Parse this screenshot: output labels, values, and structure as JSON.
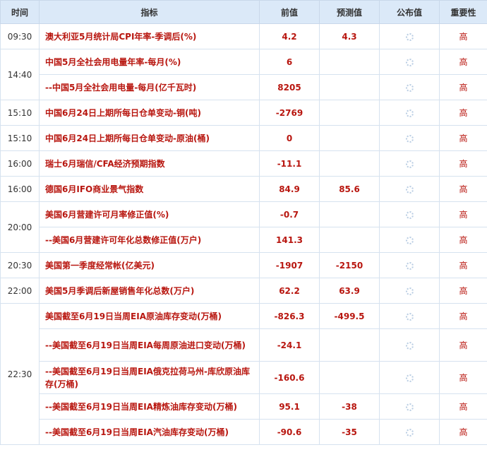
{
  "header": {
    "time": "时间",
    "indicator": "指标",
    "previous": "前值",
    "forecast": "预测值",
    "published": "公布值",
    "importance": "重要性"
  },
  "rows": [
    {
      "time": "09:30",
      "indicator": "澳大利亚5月统计局CPI年率-季调后(%)",
      "previous": "4.2",
      "forecast": "4.3",
      "importance": "高"
    },
    {
      "time": "14:40",
      "indicator": "中国5月全社会用电量年率-每月(%)",
      "previous": "6",
      "forecast": "",
      "importance": "高"
    },
    {
      "time": "",
      "indicator": "--中国5月全社会用电量-每月(亿千瓦时)",
      "previous": "8205",
      "forecast": "",
      "importance": "高"
    },
    {
      "time": "15:10",
      "indicator": "中国6月24日上期所每日仓单变动-铜(吨)",
      "previous": "-2769",
      "forecast": "",
      "importance": "高"
    },
    {
      "time": "15:10",
      "indicator": "中国6月24日上期所每日仓单变动-原油(桶)",
      "previous": "0",
      "forecast": "",
      "importance": "高"
    },
    {
      "time": "16:00",
      "indicator": "瑞士6月瑞信/CFA经济预期指数",
      "previous": "-11.1",
      "forecast": "",
      "importance": "高"
    },
    {
      "time": "16:00",
      "indicator": "德国6月IFO商业景气指数",
      "previous": "84.9",
      "forecast": "85.6",
      "importance": "高"
    },
    {
      "time": "20:00",
      "indicator": "美国6月营建许可月率修正值(%)",
      "previous": "-0.7",
      "forecast": "",
      "importance": "高"
    },
    {
      "time": "",
      "indicator": "--美国6月营建许可年化总数修正值(万户)",
      "previous": "141.3",
      "forecast": "",
      "importance": "高"
    },
    {
      "time": "20:30",
      "indicator": "美国第一季度经常帐(亿美元)",
      "previous": "-1907",
      "forecast": "-2150",
      "importance": "高"
    },
    {
      "time": "22:00",
      "indicator": "美国5月季调后新屋销售年化总数(万户)",
      "previous": "62.2",
      "forecast": "63.9",
      "importance": "高"
    },
    {
      "time": "22:30",
      "indicator": "美国截至6月19日当周EIA原油库存变动(万桶)",
      "previous": "-826.3",
      "forecast": "-499.5",
      "importance": "高"
    },
    {
      "time": "",
      "indicator": "--美国截至6月19日当周EIA每周原油进口变动(万桶)",
      "previous": "-24.1",
      "forecast": "",
      "importance": "高"
    },
    {
      "time": "",
      "indicator": "--美国截至6月19日当周EIA俄克拉荷马州-库欣原油库存(万桶)",
      "previous": "-160.6",
      "forecast": "",
      "importance": "高"
    },
    {
      "time": "",
      "indicator": "--美国截至6月19日当周EIA精炼油库存变动(万桶)",
      "previous": "95.1",
      "forecast": "-38",
      "importance": "高"
    },
    {
      "time": "",
      "indicator": "--美国截至6月19日当周EIA汽油库存变动(万桶)",
      "previous": "-90.6",
      "forecast": "-35",
      "importance": "高"
    }
  ],
  "colors": {
    "header_bg": "#dbe9f8",
    "value_red": "#b8160f",
    "border": "#d6e2ef"
  },
  "icons": {
    "published_placeholder": "loading-spinner-icon"
  }
}
